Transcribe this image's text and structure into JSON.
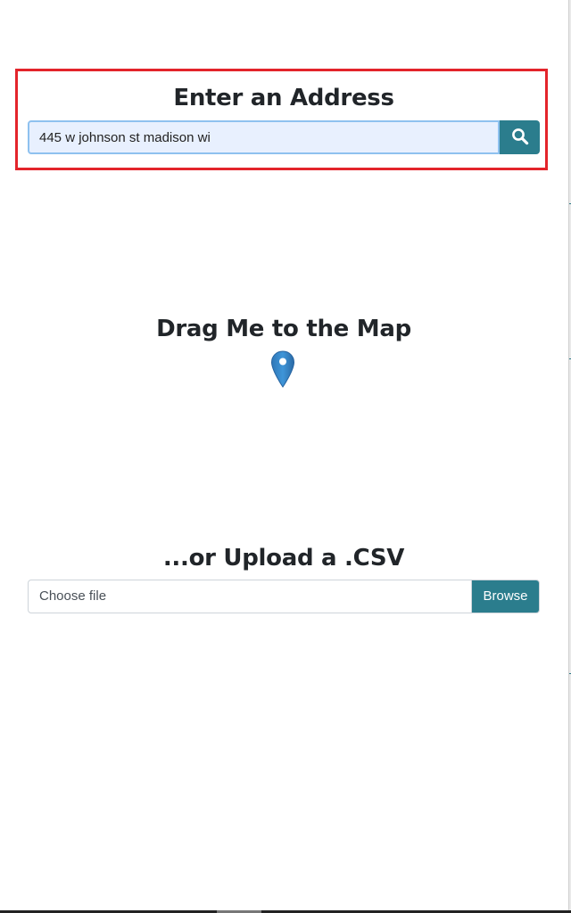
{
  "address_section": {
    "title": "Enter an Address",
    "input_value": "445 w johnson st madison wi",
    "search_icon": "search-icon"
  },
  "drag_section": {
    "title": "Drag Me to the Map",
    "pin_icon": "map-pin-icon",
    "pin_color": "#3a87c8"
  },
  "upload_section": {
    "title": "...or Upload a .CSV",
    "file_placeholder": "Choose file",
    "browse_label": "Browse"
  },
  "colors": {
    "accent": "#2b7d8d",
    "highlight": "#e3242b",
    "input_fill": "#e8f0fe"
  }
}
